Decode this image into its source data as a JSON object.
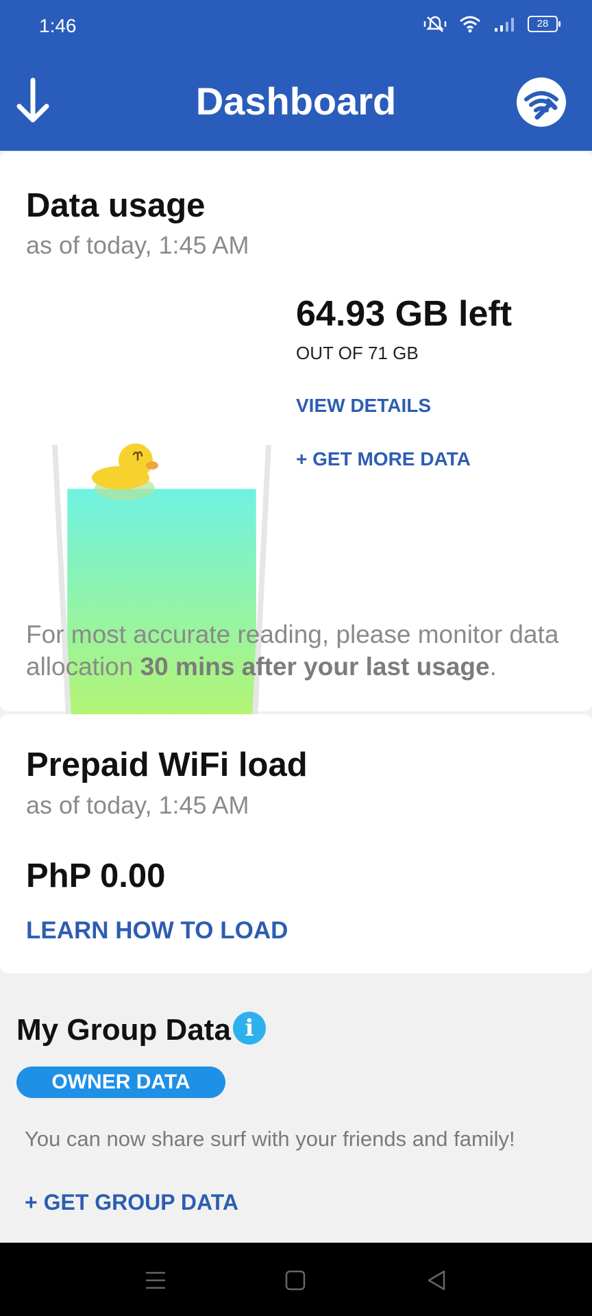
{
  "status_bar": {
    "time": "1:46",
    "battery": "28",
    "icons": [
      "mute-vibrate-icon",
      "wifi-icon",
      "signal-icon",
      "battery-icon"
    ]
  },
  "app_bar": {
    "title": "Dashboard",
    "left_icon": "download-arrow-icon",
    "right_icon": "wifi-wrench-icon",
    "color": "#2a5dbb"
  },
  "data_usage": {
    "title": "Data usage",
    "as_of": "as of today, 1:45 AM",
    "remaining": "64.93 GB left",
    "out_of": "OUT OF 71 GB",
    "view_details": "VIEW DETAILS",
    "get_more": "+ GET MORE DATA",
    "note_prefix": "For most accurate reading, please monitor data allocation ",
    "note_bold": "30 mins after your last usage",
    "note_suffix": ".",
    "fill_fraction": 0.914
  },
  "prepaid": {
    "title": "Prepaid WiFi load",
    "as_of": "as of today, 1:45 AM",
    "amount": "PhP 0.00",
    "learn": "LEARN HOW TO LOAD"
  },
  "group_data": {
    "title": "My Group Data",
    "badge": "OWNER DATA",
    "note": "You can now share surf with your friends and family!",
    "get_group": "+ GET GROUP DATA"
  },
  "nav_bar": {
    "buttons": [
      "menu-icon",
      "home-icon",
      "back-icon"
    ]
  },
  "colors": {
    "link": "#2d5db2",
    "pill": "#1e90e6",
    "info": "#2fb0ee"
  }
}
